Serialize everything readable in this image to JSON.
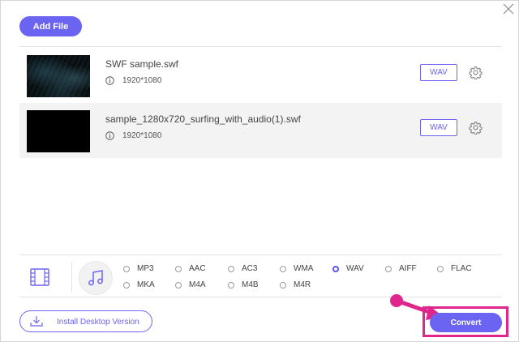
{
  "toolbar": {
    "add_file_label": "Add File"
  },
  "files": [
    {
      "name": "SWF sample.swf",
      "resolution": "1920*1080",
      "format": "WAV"
    },
    {
      "name": "sample_1280x720_surfing_with_audio(1).swf",
      "resolution": "1920*1080",
      "format": "WAV"
    }
  ],
  "formats": {
    "row1": [
      "MP3",
      "AAC",
      "AC3",
      "WMA",
      "WAV",
      "AIFF",
      "FLAC"
    ],
    "row2": [
      "MKA",
      "M4A",
      "M4B",
      "M4R"
    ],
    "selected": "WAV"
  },
  "footer": {
    "install_label": "Install Desktop Version",
    "convert_label": "Convert"
  },
  "colors": {
    "accent": "#6b64f3",
    "highlight": "#e0268c"
  },
  "icons": {
    "close": "close-icon",
    "info": "info-icon",
    "settings": "gear-icon",
    "video": "film-icon",
    "audio": "music-note-icon",
    "download": "download-icon",
    "annotation": "arrow-annotation"
  }
}
